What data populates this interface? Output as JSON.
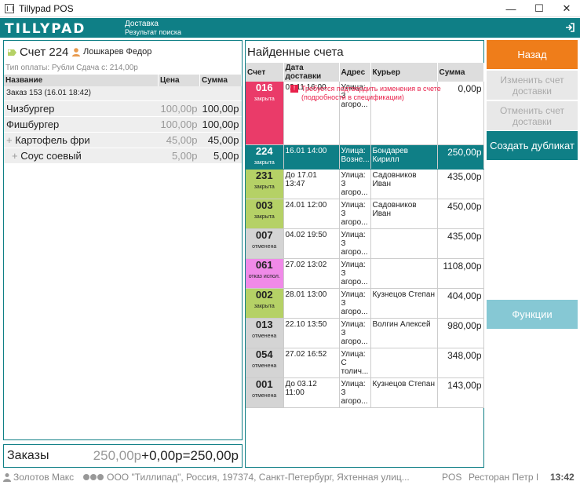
{
  "window": {
    "title": "Tillypad POS",
    "minimize": "—",
    "maximize": "☐",
    "close": "✕"
  },
  "header": {
    "logo": "TILLYPAD",
    "breadcrumb_1": "Доставка",
    "breadcrumb_2": "Результат поиска"
  },
  "check": {
    "title": "Счет 224",
    "waiter": "Лошкарев Федор",
    "payment": "Тип оплаты: Рубли Сдача с: 214,00р",
    "columns": [
      "Название",
      "Цена",
      "Сумма"
    ],
    "order_label": "Заказ 153 (16.01 18:42)",
    "items": [
      {
        "name": "Чизбургер",
        "price": "100,00р",
        "sum": "100,00р"
      },
      {
        "name": "Фишбургер",
        "price": "100,00р",
        "sum": "100,00р"
      },
      {
        "name": "Картофель фри",
        "price": "45,00р",
        "sum": "45,00р"
      },
      {
        "name": "Соус соевый",
        "price": "5,00р",
        "sum": "5,00р"
      }
    ]
  },
  "orders_bar": {
    "label": "Заказы",
    "base": "250,00р",
    "plus": "+",
    "extra": "0,00р",
    "eq": "=",
    "total": "250,00р"
  },
  "results": {
    "title": "Найденные счета",
    "columns": [
      "Счет",
      "Дата доставки",
      "Адрес",
      "Курьер",
      "Сумма"
    ],
    "warning": "Требуется подтвердить изменения в счете (подробности в спецификации)",
    "rows": [
      {
        "num": "016",
        "status": "закрыта",
        "date": "02.11 16:00",
        "address": "Улица: З агоро...",
        "courier": "",
        "sum": "0,00р",
        "color": "#ea3b69"
      },
      {
        "num": "224",
        "status": "закрыта",
        "date": "16.01 14:00",
        "address": "Улица: Возне...",
        "courier": "Бондарев Кирилл",
        "sum": "250,00р",
        "color": "#0f7f86"
      },
      {
        "num": "231",
        "status": "закрыта",
        "date": "До 17.01 13:47",
        "address": "Улица: З агоро...",
        "courier": "Садовников Иван",
        "sum": "435,00р",
        "color": "#b5d166"
      },
      {
        "num": "003",
        "status": "закрыта",
        "date": "24.01 12:00",
        "address": "Улица: З агоро...",
        "courier": "Садовников Иван",
        "sum": "450,00р",
        "color": "#b5d166"
      },
      {
        "num": "007",
        "status": "отменена",
        "date": "04.02 19:50",
        "address": "Улица: З агоро...",
        "courier": "",
        "sum": "435,00р",
        "color": "#d4d4d4"
      },
      {
        "num": "061",
        "status": "отказ испол.",
        "date": "27.02 13:02",
        "address": "Улица: З агоро...",
        "courier": "",
        "sum": "1108,00р",
        "color": "#f08ae8"
      },
      {
        "num": "002",
        "status": "закрыта",
        "date": "28.01 13:00",
        "address": "Улица: З агоро...",
        "courier": "Кузнецов Степан",
        "sum": "404,00р",
        "color": "#b5d166"
      },
      {
        "num": "013",
        "status": "отменена",
        "date": "22.10 13:50",
        "address": "Улица: З агоро...",
        "courier": "Волгин Алексей",
        "sum": "980,00р",
        "color": "#d4d4d4"
      },
      {
        "num": "054",
        "status": "отменена",
        "date": "27.02 16:52",
        "address": "Улица: С толич...",
        "courier": "",
        "sum": "348,00р",
        "color": "#d4d4d4"
      },
      {
        "num": "001",
        "status": "отменена",
        "date": "До 03.12 11:00",
        "address": "Улица: З агоро...",
        "courier": "Кузнецов Степан",
        "sum": "143,00р",
        "color": "#d4d4d4"
      }
    ]
  },
  "buttons": {
    "back": "Назад",
    "edit": "Изменить счет доставки",
    "cancel": "Отменить счет доставки",
    "duplicate": "Создать дубликат",
    "functions": "Функции"
  },
  "status": {
    "user": "Золотов Макс",
    "company": "ООО \"Тиллипад\", Россия, 197374, Санкт-Петербург, Яхтенная улиц...",
    "mode": "POS",
    "restaurant": "Ресторан Петр I",
    "time": "13:42"
  }
}
